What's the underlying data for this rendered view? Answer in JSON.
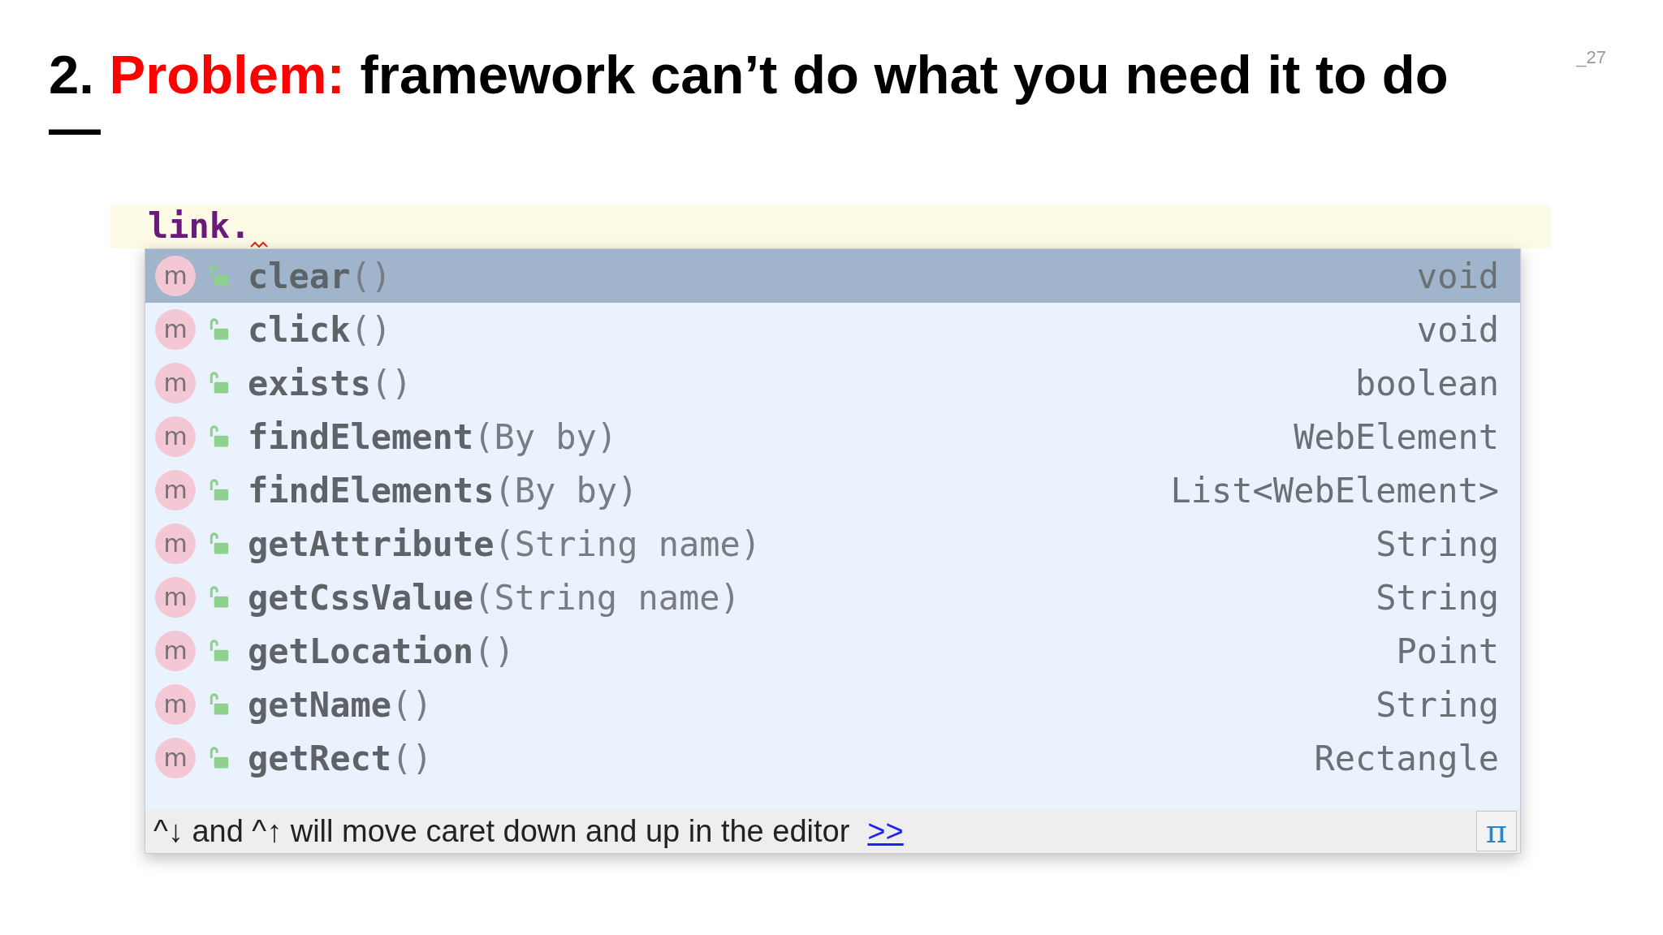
{
  "slide": {
    "page_number": "_27",
    "title": [
      {
        "text": "2. ",
        "kind": "plain"
      },
      {
        "text": "Problem:",
        "kind": "highlight"
      },
      {
        "text": " framework can’t do what you need it to do",
        "kind": "plain"
      }
    ],
    "title_dash": "—"
  },
  "editor": {
    "code": "link.",
    "error_mark": true
  },
  "completion": {
    "items": [
      {
        "icon": "m",
        "name": "clear",
        "params": "()",
        "type": "void",
        "selected": true
      },
      {
        "icon": "m",
        "name": "click",
        "params": "()",
        "type": "void",
        "selected": false
      },
      {
        "icon": "m",
        "name": "exists",
        "params": "()",
        "type": "boolean",
        "selected": false
      },
      {
        "icon": "m",
        "name": "findElement",
        "params": "(By by)",
        "type": "WebElement",
        "selected": false
      },
      {
        "icon": "m",
        "name": "findElements",
        "params": "(By by)",
        "type": "List<WebElement>",
        "selected": false
      },
      {
        "icon": "m",
        "name": "getAttribute",
        "params": "(String name)",
        "type": "String",
        "selected": false
      },
      {
        "icon": "m",
        "name": "getCssValue",
        "params": "(String name)",
        "type": "String",
        "selected": false
      },
      {
        "icon": "m",
        "name": "getLocation",
        "params": "()",
        "type": "Point",
        "selected": false
      },
      {
        "icon": "m",
        "name": "getName",
        "params": "()",
        "type": "String",
        "selected": false
      },
      {
        "icon": "m",
        "name": "getRect",
        "params": "()",
        "type": "Rectangle",
        "selected": false
      }
    ],
    "footer": {
      "hint": "^↓ and ^↑ will move caret down and up in the editor",
      "link": ">>",
      "pi_button": "π"
    }
  }
}
